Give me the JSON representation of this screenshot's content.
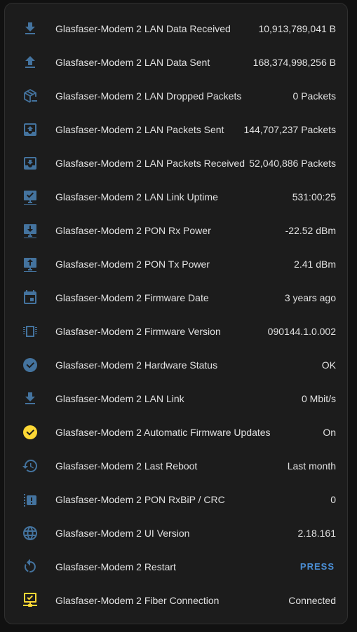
{
  "colors": {
    "icon_blue": "#44739e",
    "icon_yellow": "#fdd835",
    "accent": "#4b8fd6",
    "card_bg": "#1c1c1c",
    "text": "#e1e1e1"
  },
  "rows": [
    {
      "icon": "download-icon",
      "name": "Glasfaser-Modem 2 LAN Data Received",
      "value": "10,913,789,041 B"
    },
    {
      "icon": "upload-icon",
      "name": "Glasfaser-Modem 2 LAN Data Sent",
      "value": "168,374,998,256 B"
    },
    {
      "icon": "package-remove-icon",
      "name": "Glasfaser-Modem 2 LAN Dropped Packets",
      "value": "0 Packets"
    },
    {
      "icon": "inbox-arrow-up-icon",
      "name": "Glasfaser-Modem 2 LAN Packets Sent",
      "value": "144,707,237 Packets"
    },
    {
      "icon": "inbox-arrow-down-icon",
      "name": "Glasfaser-Modem 2 LAN Packets Received",
      "value": "52,040,886 Packets"
    },
    {
      "icon": "monitor-check-icon",
      "name": "Glasfaser-Modem 2 LAN Link Uptime",
      "value": "531:00:25"
    },
    {
      "icon": "monitor-download-icon",
      "name": "Glasfaser-Modem 2 PON Rx Power",
      "value": "-22.52 dBm"
    },
    {
      "icon": "monitor-upload-icon",
      "name": "Glasfaser-Modem 2 PON Tx Power",
      "value": "2.41 dBm"
    },
    {
      "icon": "calendar-icon",
      "name": "Glasfaser-Modem 2 Firmware Date",
      "value": "3 years ago"
    },
    {
      "icon": "chip-icon",
      "name": "Glasfaser-Modem 2 Firmware Version",
      "value": "090144.1.0.002"
    },
    {
      "icon": "check-circle-icon",
      "name": "Glasfaser-Modem 2 Hardware Status",
      "value": "OK"
    },
    {
      "icon": "download-icon",
      "name": "Glasfaser-Modem 2 LAN Link",
      "value": "0 Mbit/s"
    },
    {
      "icon": "check-circle-icon",
      "name": "Glasfaser-Modem 2 Automatic Firmware Updates",
      "value": "On"
    },
    {
      "icon": "history-icon",
      "name": "Glasfaser-Modem 2 Last Reboot",
      "value": "Last month"
    },
    {
      "icon": "alert-box-icon",
      "name": "Glasfaser-Modem 2 PON RxBiP / CRC",
      "value": "0"
    },
    {
      "icon": "web-icon",
      "name": "Glasfaser-Modem 2 UI Version",
      "value": "2.18.161"
    },
    {
      "icon": "restart-icon",
      "name": "Glasfaser-Modem 2 Restart",
      "value": "PRESS"
    },
    {
      "icon": "lan-connect-icon",
      "name": "Glasfaser-Modem 2 Fiber Connection",
      "value": "Connected"
    }
  ]
}
